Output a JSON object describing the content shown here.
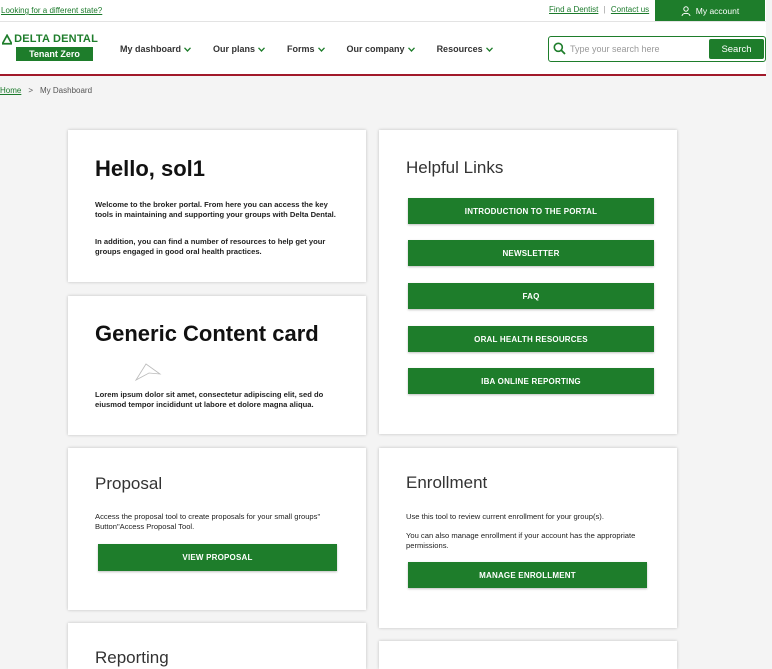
{
  "topbar": {
    "state_link": "Looking for a different state?",
    "find_dentist": "Find a Dentist",
    "contact_us": "Contact us",
    "separator": "|",
    "my_account": "My account"
  },
  "header": {
    "logo_brand": "DELTA DENTAL",
    "logo_tenant": "Tenant Zero",
    "nav": [
      "My dashboard",
      "Our plans",
      "Forms",
      "Our company",
      "Resources"
    ],
    "search_placeholder": "Type your search here",
    "search_button": "Search"
  },
  "breadcrumb": {
    "home": "Home",
    "separator": ">",
    "current": "My Dashboard"
  },
  "cards": {
    "hello": {
      "title": "Hello, sol1",
      "p1": "Welcome to the broker portal. From here you can access the key tools in maintaining and supporting your groups with Delta Dental.",
      "p2": "In addition, you can find a number of resources to help get your groups engaged in good oral health practices."
    },
    "generic": {
      "title": "Generic Content card",
      "body": "Lorem ipsum dolor sit amet, consectetur adipiscing elit, sed do eiusmod tempor incididunt ut labore et dolore magna aliqua."
    },
    "helpful": {
      "title": "Helpful Links",
      "links": [
        "INTRODUCTION TO THE PORTAL",
        "NEWSLETTER",
        "FAQ",
        "ORAL HEALTH RESOURCES",
        "IBA ONLINE REPORTING"
      ]
    },
    "proposal": {
      "title": "Proposal",
      "body": "Access the proposal tool to create proposals for your small groups\" Button\"Access Proposal Tool.",
      "button": "VIEW PROPOSAL"
    },
    "enrollment": {
      "title": "Enrollment",
      "p1": "Use this tool to review current enrollment for your group(s).",
      "p2": "You can also manage enrollment if your account has the appropriate permissions.",
      "button": "MANAGE ENROLLMENT"
    },
    "reporting": {
      "title": "Reporting"
    }
  },
  "colors": {
    "brand_green": "#1e7d2b",
    "header_rule": "#a1192a"
  }
}
